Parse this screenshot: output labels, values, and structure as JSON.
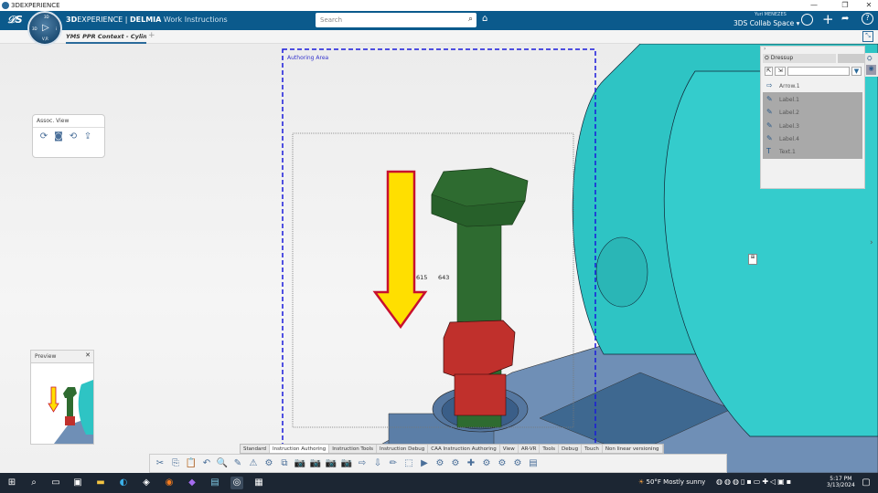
{
  "window": {
    "title": "3DEXPERIENCE",
    "controls": [
      "—",
      "❐",
      "✕"
    ]
  },
  "header": {
    "brand_prefix": "3D",
    "brand_main": "EXPERIENCE",
    "separator": " | ",
    "product": "DELMIA",
    "app": "Work Instructions",
    "search_placeholder": "Search",
    "user": "Yuri MENEZES",
    "collab_space": "3DS Collab Space",
    "compass": {
      "top": "3D",
      "left": "3D",
      "right": "i",
      "bottom": "V,R"
    }
  },
  "tabs": [
    {
      "label": "YMS PPR Context - Cylinder",
      "active": true
    }
  ],
  "tab_add": "+",
  "viewport": {
    "authoring_area_label": "Authoring Area",
    "labels": [
      "615",
      "643"
    ],
    "colors": {
      "bolt": "#2e6b30",
      "nut": "#c0302c",
      "arrow_fill": "#ffdf00",
      "arrow_stroke": "#c8102e",
      "cylinder": "#2ec4c4",
      "base": "#6b8db5",
      "authoring_border": "#1a1adb"
    }
  },
  "assoc_view": {
    "title": "Assoc. View",
    "icons": [
      "refresh-icon",
      "camera-icon",
      "update-view-icon",
      "export-icon"
    ]
  },
  "preview": {
    "title": "Preview",
    "close": "✕"
  },
  "dressup": {
    "title": "Dressup",
    "items": [
      {
        "label": "Arrow.1",
        "icon": "arrow-icon",
        "selected": false
      },
      {
        "label": "Label.1",
        "icon": "label-icon",
        "selected": true
      },
      {
        "label": "Label.2",
        "icon": "label-icon",
        "selected": true
      },
      {
        "label": "Label.3",
        "icon": "label-icon",
        "selected": true
      },
      {
        "label": "Label.4",
        "icon": "label-icon",
        "selected": true
      },
      {
        "label": "Text.1",
        "icon": "text-icon",
        "selected": true
      }
    ]
  },
  "toolbar_tabs": [
    "Standard",
    "Instruction Authoring",
    "Instruction Tools",
    "Instruction Debug",
    "CAA Instruction Authoring",
    "View",
    "AR-VR",
    "Tools",
    "Debug",
    "Touch",
    "Non linear versioning"
  ],
  "toolbar_active": "Instruction Authoring",
  "toolbar_icons": [
    "✂",
    "⎘",
    "📋",
    "↶",
    "🔍",
    "✎",
    "⚠",
    "⚙",
    "⧉",
    "📷",
    "📷",
    "📷",
    "📷",
    "⇨",
    "⇩",
    "✏",
    "⬚",
    "▶",
    "⚙",
    "⚙",
    "✚",
    "⚙",
    "⚙",
    "⚙",
    "▤"
  ],
  "taskbar": {
    "weather": "50°F  Mostly sunny",
    "time": "5:17 PM",
    "date": "3/13/2024"
  }
}
